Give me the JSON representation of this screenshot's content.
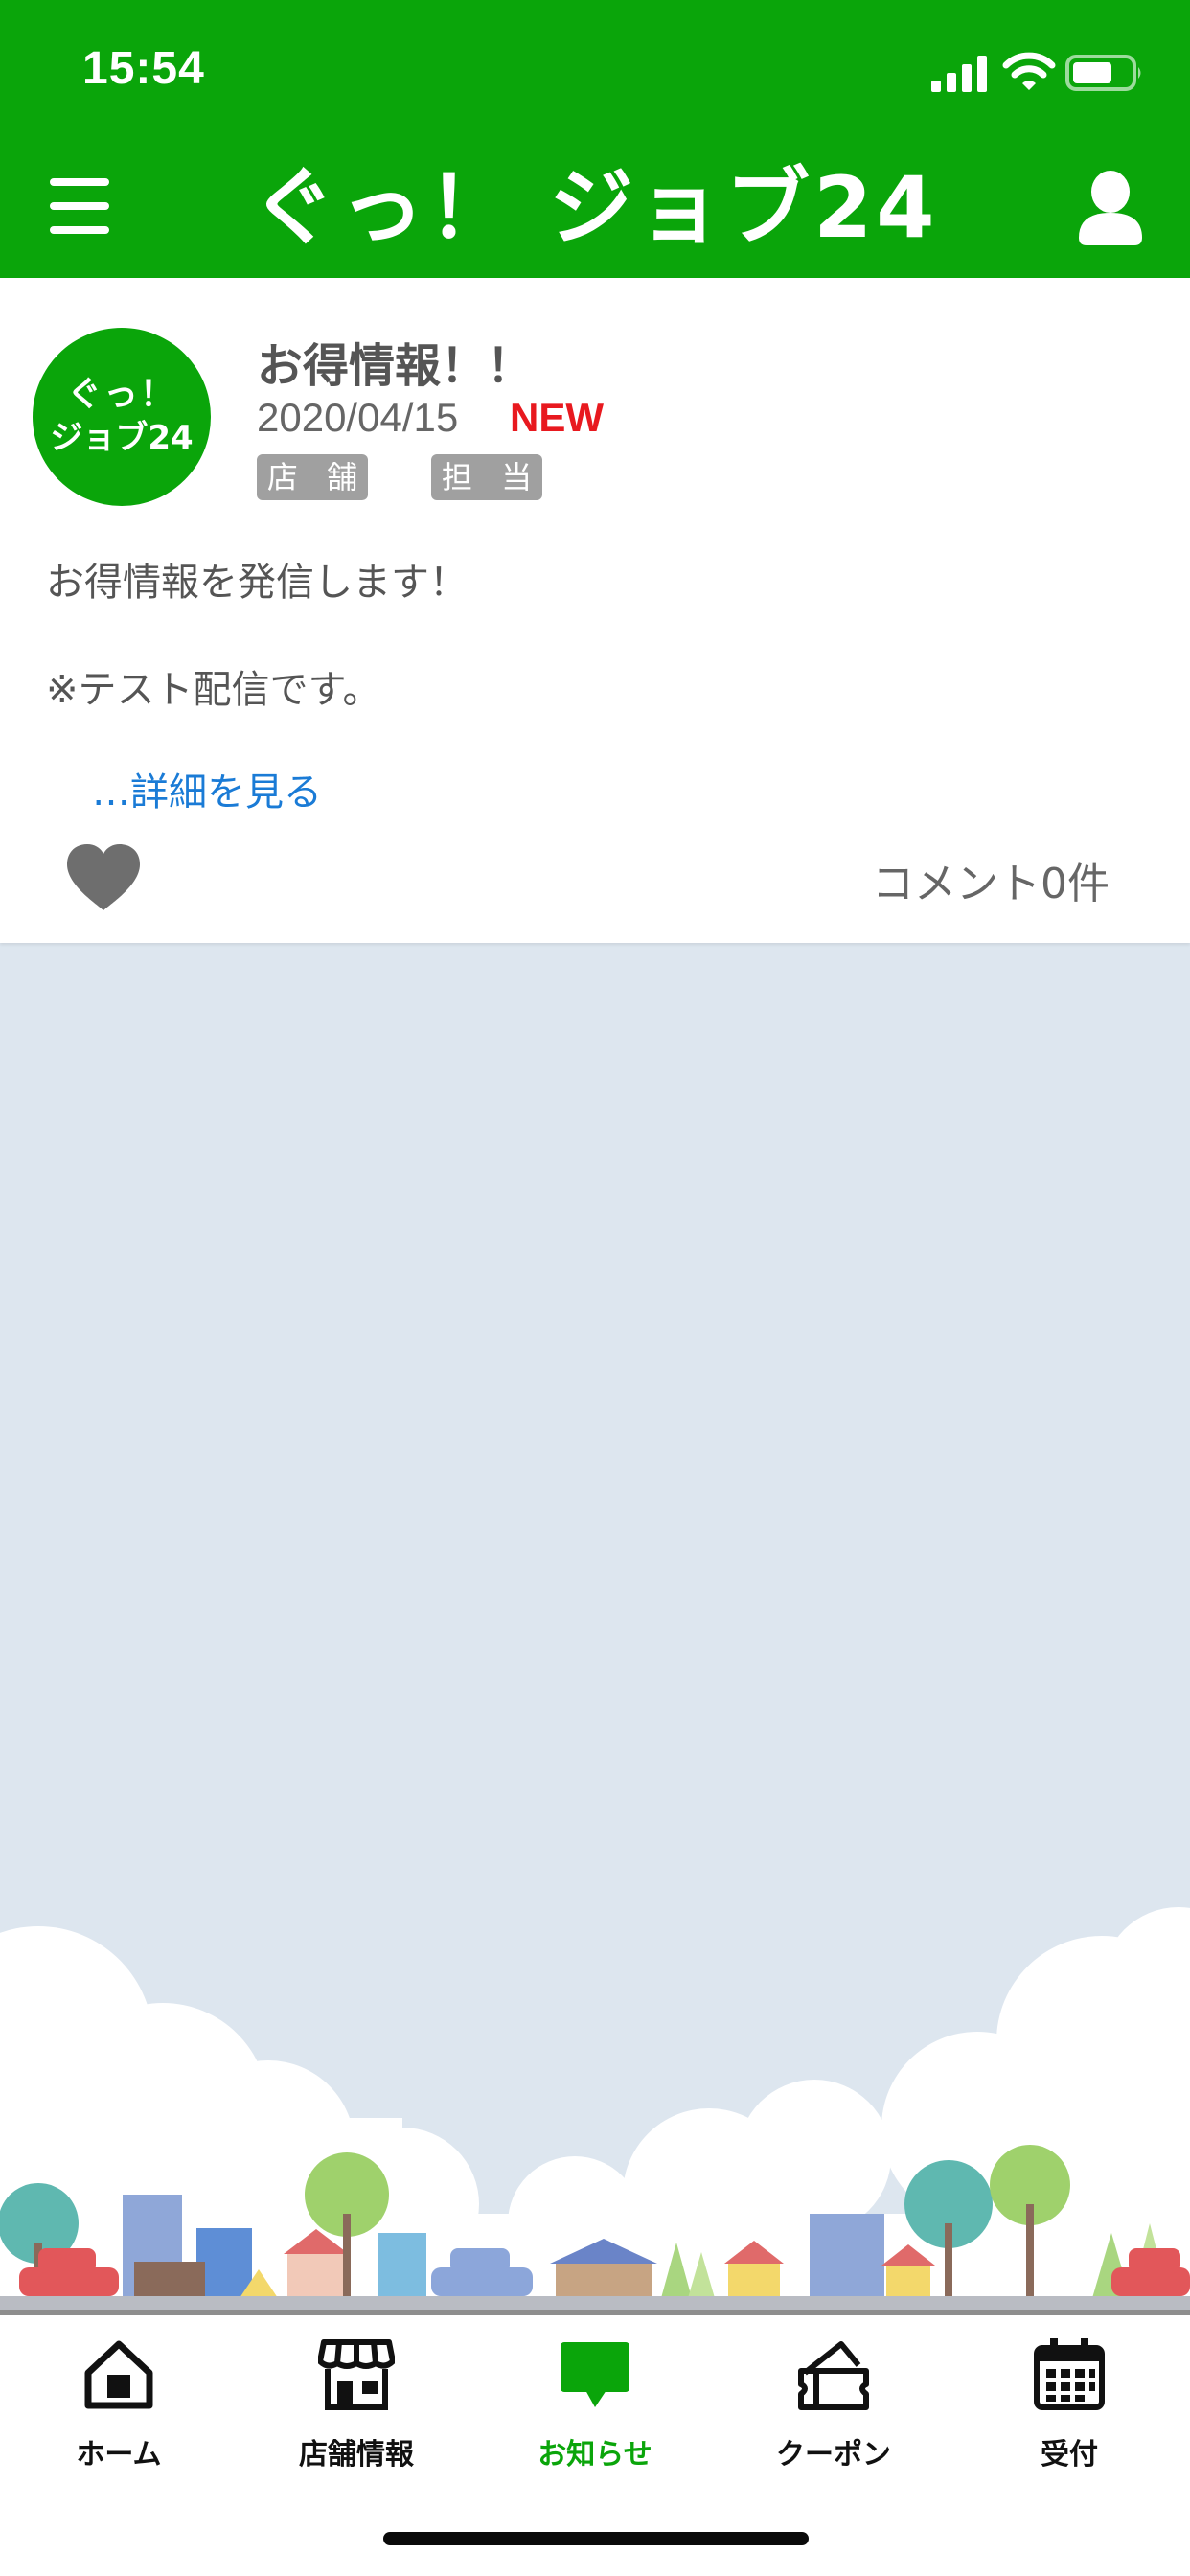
{
  "status_bar": {
    "time": "15:54"
  },
  "header": {
    "title": "ぐっ！ ジョブ24",
    "menu_icon": "hamburger-icon",
    "profile_icon": "user-icon",
    "background_color": "#0aa50a"
  },
  "post": {
    "avatar_line1": "ぐっ！",
    "avatar_line2": "ジョブ24",
    "title": "お得情報！！",
    "date": "2020/04/15",
    "new_badge": "NEW",
    "tags": [
      "店 舗",
      "担 当"
    ],
    "body_line1": "お得情報を発信します！",
    "body_line2": "※テスト配信です。",
    "more_link": "…詳細を見る",
    "like_icon": "heart-icon",
    "comment_count": "コメント0件"
  },
  "tabbar": {
    "active_color": "#0aa50a",
    "items": [
      {
        "label": "ホーム",
        "icon": "home-icon"
      },
      {
        "label": "店舗情報",
        "icon": "store-icon"
      },
      {
        "label": "お知らせ",
        "icon": "speech-bubble-icon"
      },
      {
        "label": "クーポン",
        "icon": "coupon-icon"
      },
      {
        "label": "受付",
        "icon": "calendar-icon"
      }
    ]
  }
}
